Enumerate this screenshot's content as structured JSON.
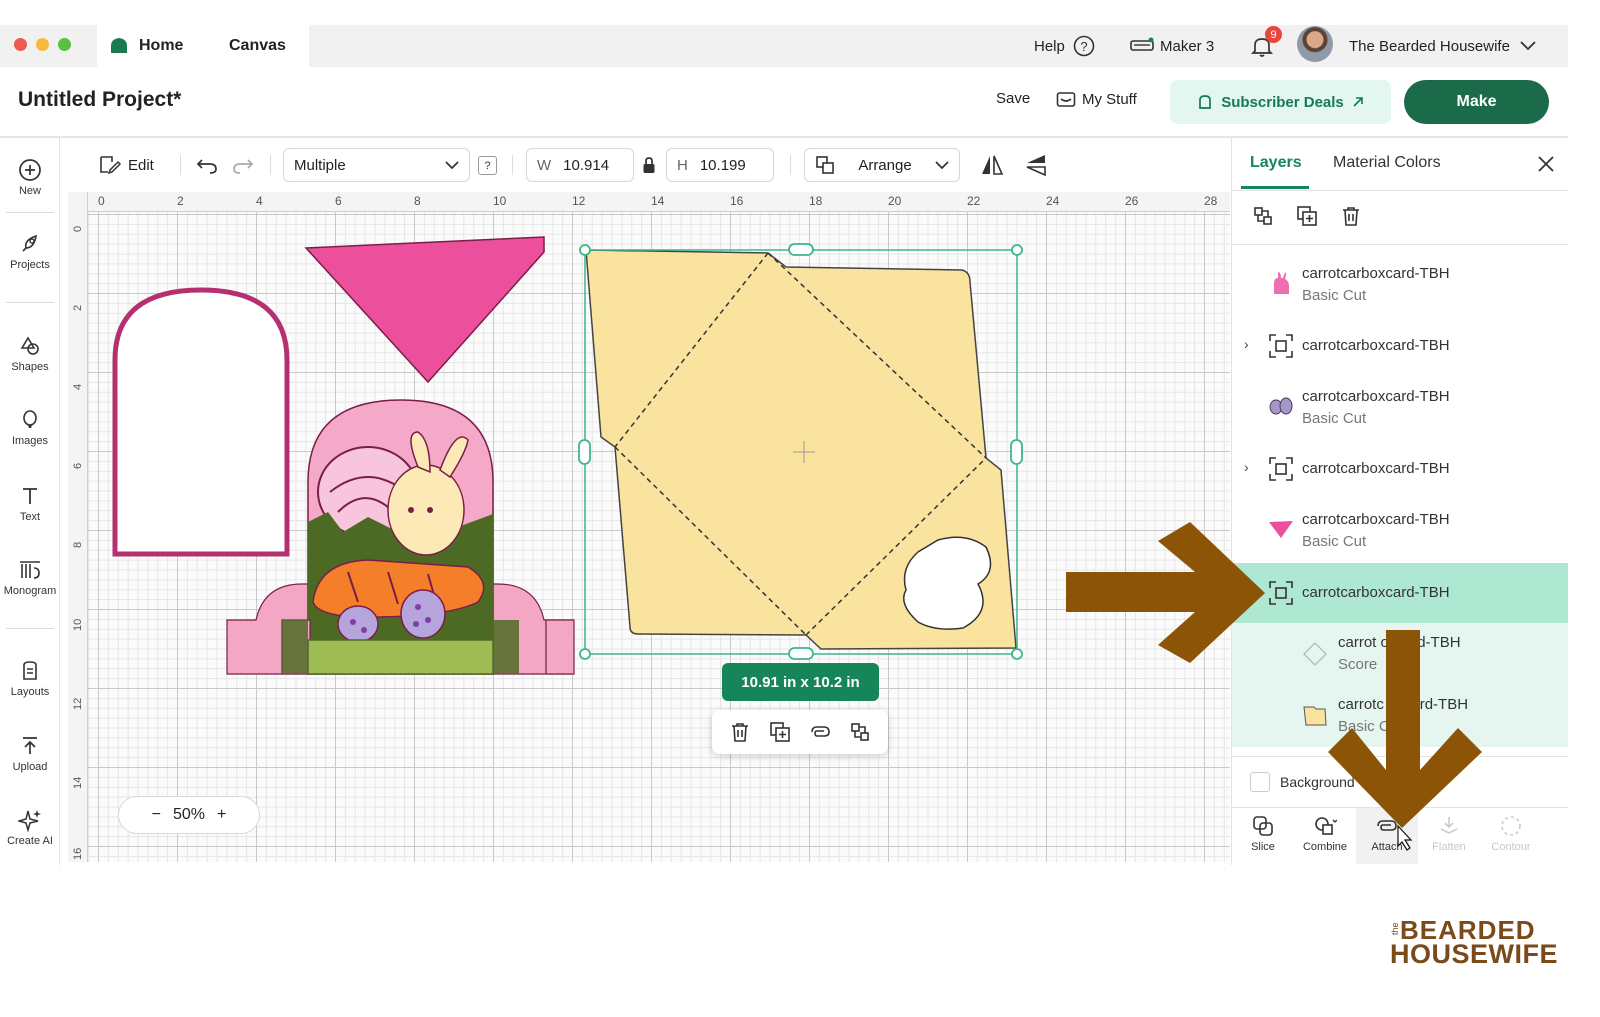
{
  "titlebar": {
    "tab_home": "Home",
    "tab_canvas": "Canvas",
    "help": "Help",
    "machine": "Maker 3",
    "notification_count": "9",
    "user_name": "The Bearded Housewife"
  },
  "header": {
    "project_title": "Untitled Project*",
    "save": "Save",
    "my_stuff": "My Stuff",
    "subscriber_deals": "Subscriber Deals",
    "make": "Make"
  },
  "leftnav": {
    "new": "New",
    "projects": "Projects",
    "shapes": "Shapes",
    "images": "Images",
    "text": "Text",
    "monogram": "Monogram",
    "layouts": "Layouts",
    "upload": "Upload",
    "create_ai": "Create AI"
  },
  "toolbar": {
    "edit": "Edit",
    "operation": "Multiple",
    "help_mark": "?",
    "w_label": "W",
    "w_value": "10.914",
    "h_label": "H",
    "h_value": "10.199",
    "arrange": "Arrange"
  },
  "ruler": {
    "top": [
      "0",
      "2",
      "4",
      "6",
      "8",
      "10",
      "12",
      "14",
      "16",
      "18",
      "20",
      "22",
      "24",
      "26",
      "28"
    ],
    "left": [
      "0",
      "2",
      "4",
      "6",
      "8",
      "10",
      "12",
      "14",
      "16"
    ]
  },
  "canvas": {
    "size_badge": "10.91  in x 10.2  in",
    "zoom": "50%",
    "zoom_minus": "−",
    "zoom_plus": "+"
  },
  "panel": {
    "tab_layers": "Layers",
    "tab_material": "Material Colors",
    "layers": [
      {
        "name": "carrotcarboxcard-TBH",
        "sub": "Basic Cut"
      },
      {
        "name": "carrotcarboxcard-TBH"
      },
      {
        "name": "carrotcarboxcard-TBH",
        "sub": "Basic Cut"
      },
      {
        "name": "carrotcarboxcard-TBH"
      },
      {
        "name": "carrotcarboxcard-TBH",
        "sub": "Basic Cut"
      },
      {
        "name": "carrotcarboxcard-TBH"
      },
      {
        "name": "carrot   oxcard-TBH",
        "sub": "Score"
      },
      {
        "name": "carrotc   oxcard-TBH",
        "sub": "Basic C"
      }
    ],
    "background": "Background",
    "tools": {
      "slice": "Slice",
      "combine": "Combine",
      "attach": "Attach",
      "flatten": "Flatten",
      "contour": "Contour"
    }
  },
  "watermark": {
    "the": "the",
    "line1": "BEARDED",
    "line2": "HOUSEWIFE"
  },
  "colors": {
    "accent_green": "#16865a",
    "make_green": "#1b6b4a",
    "envelope": "#fae29f",
    "pink": "#ec4f9b",
    "arrow_brown": "#8c5406"
  }
}
